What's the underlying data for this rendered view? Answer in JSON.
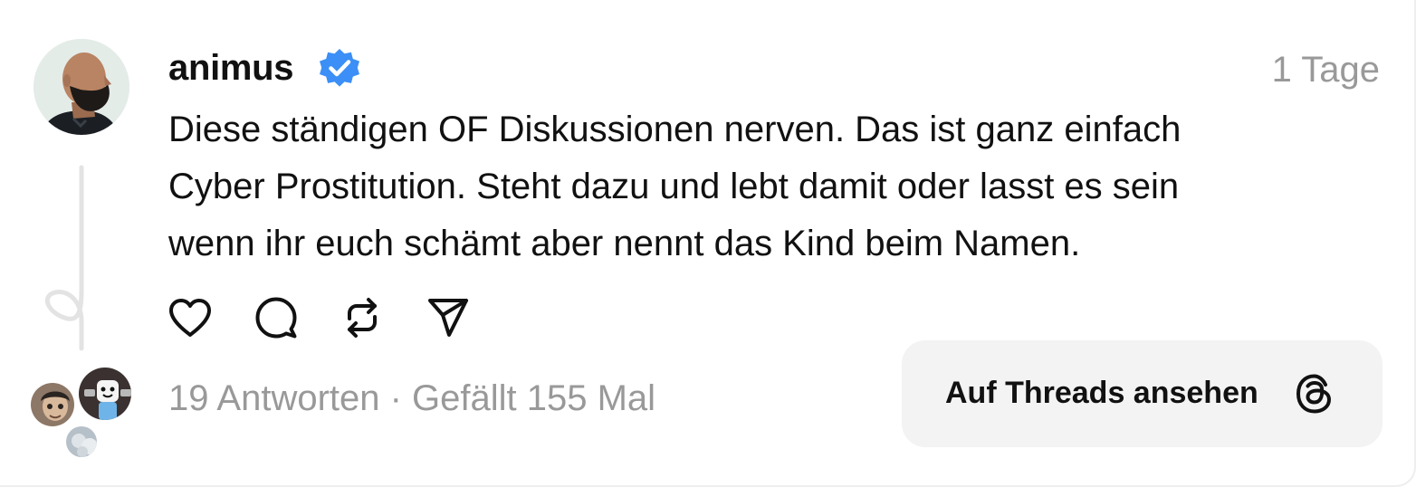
{
  "post": {
    "username": "animus",
    "verified": true,
    "timestamp": "1 Tage",
    "text_lines": [
      "Diese ständigen OF Diskussionen nerven. Das ist ganz einfach",
      "Cyber Prostitution. Steht dazu und lebt damit oder lasst es sein",
      "wenn ihr euch schämt aber nennt das Kind beim Namen."
    ],
    "stats": "19 Antworten · Gefällt 155 Mal"
  },
  "actions": [
    {
      "name": "like",
      "icon": "heart-icon"
    },
    {
      "name": "reply",
      "icon": "comment-icon"
    },
    {
      "name": "repost",
      "icon": "repost-icon"
    },
    {
      "name": "share",
      "icon": "send-icon"
    }
  ],
  "view_button": {
    "label": "Auf Threads ansehen",
    "icon": "threads-logo-icon"
  },
  "colors": {
    "text": "#111111",
    "muted": "#999999",
    "verified_blue": "#3b8ff6",
    "button_bg": "#f3f3f3",
    "thread_line": "#e3e3e3"
  }
}
